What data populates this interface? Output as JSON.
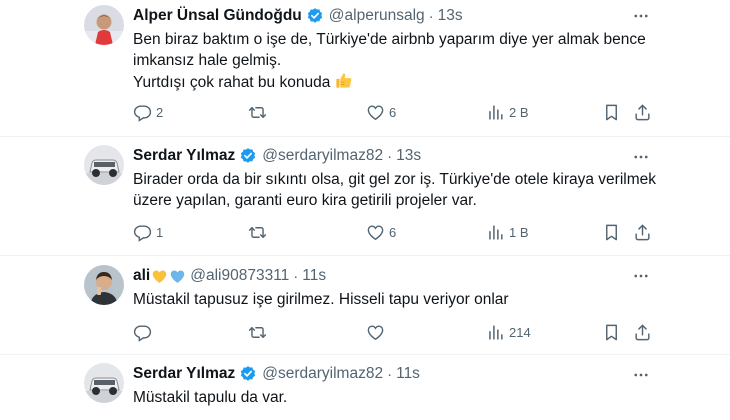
{
  "tweets": [
    {
      "name": "Alper Ünsal Gündoğdu",
      "handle": "@alperunsalg",
      "time": "13s",
      "lines": [
        "Ben biraz baktım o işe de, Türkiye'de airbnb yaparım diye yer almak bence",
        "imkansız hale gelmiş.",
        "Yurtdışı çok rahat bu konuda"
      ],
      "stats": {
        "replies": "2",
        "retweets": "",
        "likes": "6",
        "views": "2 B"
      }
    },
    {
      "name": "Serdar Yılmaz",
      "handle": "@serdaryilmaz82",
      "time": "13s",
      "lines": [
        "Birader orda da bir sıkıntı olsa, git gel zor iş. Türkiye'de otele kiraya verilmek",
        "üzere yapılan, garanti euro kira getirili projeler var."
      ],
      "stats": {
        "replies": "1",
        "retweets": "",
        "likes": "6",
        "views": "1 B"
      }
    },
    {
      "name": "ali",
      "handle": "@ali90873311",
      "time": "11s",
      "lines": [
        "Müstakil tapusuz işe girilmez. Hisseli tapu veriyor onlar"
      ],
      "stats": {
        "replies": "",
        "retweets": "",
        "likes": "",
        "views": "214"
      }
    },
    {
      "name": "Serdar Yılmaz",
      "handle": "@serdaryilmaz82",
      "time": "11s",
      "lines": [
        "Müstakil tapulu da var."
      ]
    }
  ],
  "colors": {
    "text": "#0f1419",
    "secondary": "#536471",
    "verified_blue": "#1d9bf0",
    "divider": "#eff3f4"
  },
  "icons": {
    "reply": "reply-icon",
    "retweet": "retweet-icon",
    "like": "heart-icon",
    "views": "views-icon",
    "bookmark": "bookmark-icon",
    "share": "share-icon",
    "more": "more-icon",
    "verified": "verified-badge-icon"
  }
}
